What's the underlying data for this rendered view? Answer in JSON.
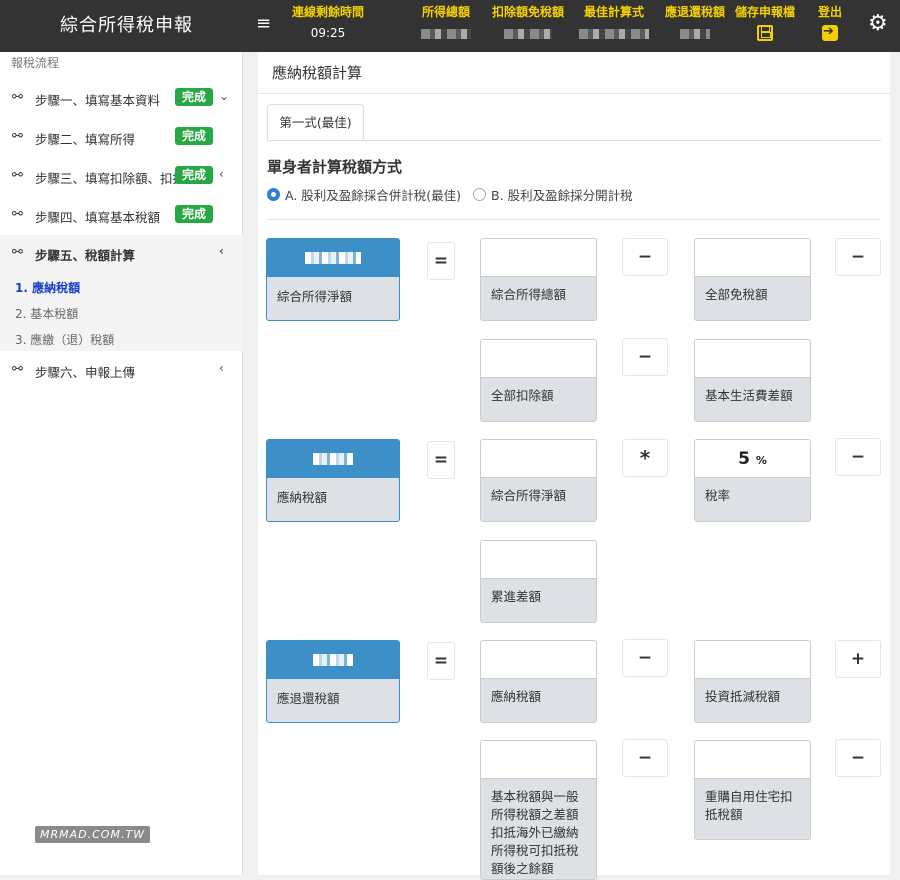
{
  "header": {
    "title": "綜合所得稅申報",
    "remaining_label": "連線剩餘時間",
    "remaining_value": "09:25",
    "total_income_label": "所得總額",
    "deduction_label": "扣除額免稅額",
    "best_formula_label": "最佳計算式",
    "refund_label": "應退還稅額",
    "save_label": "儲存申報檔",
    "logout_label": "登出",
    "accent_color": "#f5d000"
  },
  "sidebar": {
    "heading": "報稅流程",
    "steps": [
      {
        "label": "步驟一、填寫基本資料",
        "badge": "完成"
      },
      {
        "label": "步驟二、填寫所得",
        "badge": "完成"
      },
      {
        "label": "步驟三、填寫扣除額、扣抵",
        "badge": "完成"
      },
      {
        "label": "步驟四、填寫基本稅額",
        "badge": "完成"
      },
      {
        "label": "步驟五、稅額計算",
        "badge": ""
      },
      {
        "label": "步驟六、申報上傳",
        "badge": ""
      }
    ],
    "sub_items": [
      "1. 應納稅額",
      "2. 基本稅額",
      "3. 應繳（退）稅額"
    ],
    "watermark": "MRMAD.COM.TW"
  },
  "main": {
    "title": "應納稅額計算",
    "tab": "第一式(最佳)",
    "section_title": "單身者計算稅額方式",
    "radio_a": "A. 股利及盈餘採合併計稅(最佳)",
    "radio_b": "B. 股利及盈餘採分開計稅",
    "rows": {
      "r1_result": "綜合所得淨額",
      "r1_eq": "=",
      "r1_a": "綜合所得總額",
      "r1_op1": "−",
      "r1_b": "全部免稅額",
      "r1_op2": "−",
      "r2_op1": "−",
      "r2_a": "全部扣除額",
      "r2_b": "基本生活費差額",
      "r3_result": "應納稅額",
      "r3_eq": "=",
      "r3_a": "綜合所得淨額",
      "r3_op1": "*",
      "r3_rate_value": "5",
      "r3_rate_unit": "%",
      "r3_b": "稅率",
      "r3_op2": "−",
      "r4_a": "累進差額",
      "r5_result": "應退還稅額",
      "r5_eq": "=",
      "r5_a": "應納稅額",
      "r5_op1": "−",
      "r5_b": "投資抵減稅額",
      "r5_op2": "+",
      "r6_a": "基本稅額與一般所得稅額之差額扣抵海外已繳納所得稅可扣抵稅額後之餘額",
      "r6_op1": "−",
      "r6_b": "重購自用住宅扣抵稅額",
      "r6_op2": "−"
    }
  }
}
